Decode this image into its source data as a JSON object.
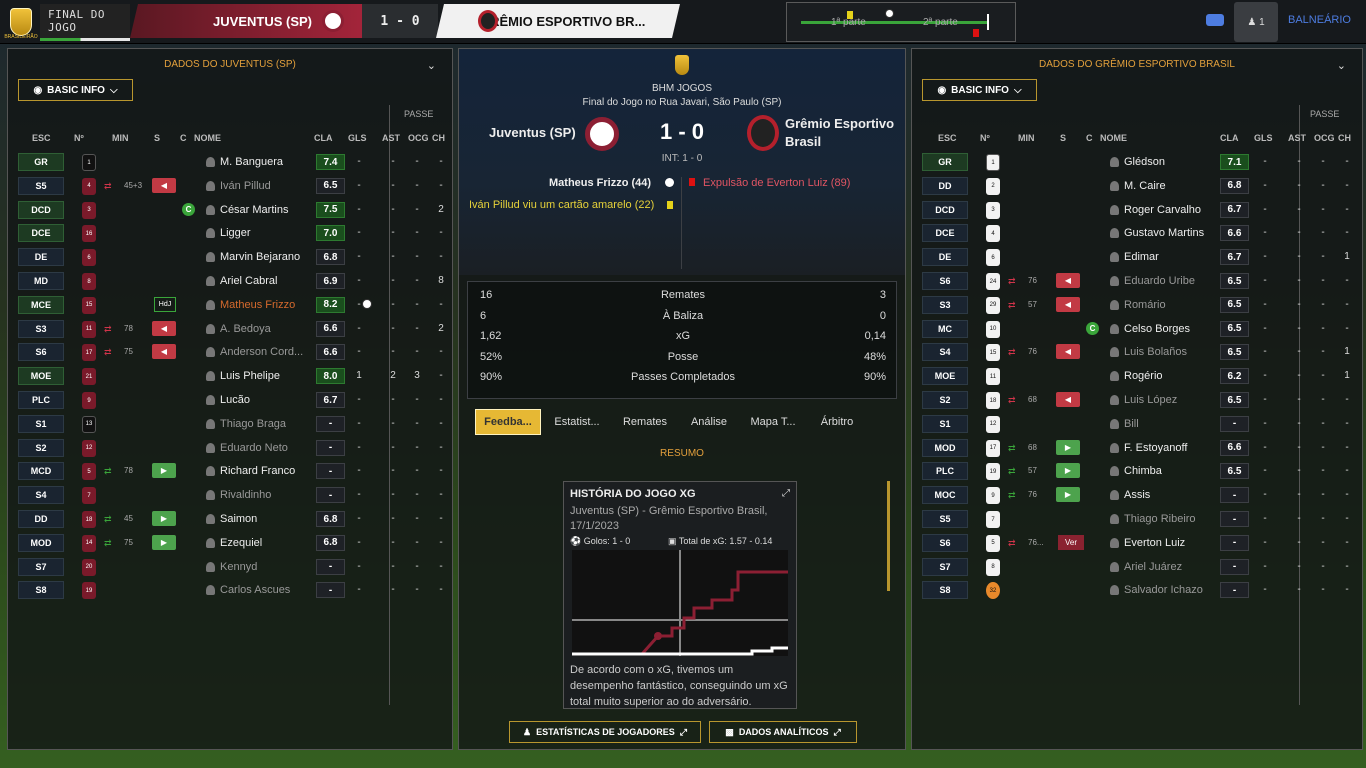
{
  "topbar": {
    "logo_text": "BRASILEIRÃO",
    "final": "FINAL DO JOGO",
    "home": "JUVENTUS (SP)",
    "score": "1 - 0",
    "away": "GRÊMIO ESPORTIVO BR...",
    "tl_half1": "1ª parte",
    "tl_half2": "2ª parte",
    "user_count": "1",
    "balneario": "BALNEÁRIO"
  },
  "left": {
    "title": "DADOS DO JUVENTUS (SP)",
    "basic": "BASIC INFO",
    "passe": "PASSE",
    "headers": [
      "ESC",
      "Nº",
      "MIN",
      "S",
      "C",
      "NOME",
      "CLA",
      "GLS",
      "AST",
      "OCG",
      "CH"
    ],
    "players": [
      {
        "pos": "GR",
        "num": "1",
        "name": "M. Banguera",
        "rating": "7.4",
        "gls": "-",
        "ast": "-",
        "ocg": "-",
        "ch": "-",
        "good": true,
        "gk": true
      },
      {
        "pos": "S5",
        "num": "4",
        "name": "Iván Pillud",
        "rating": "6.5",
        "gls": "-",
        "ast": "-",
        "ocg": "-",
        "ch": "-",
        "sub": "45+3",
        "subout": true,
        "dim": true
      },
      {
        "pos": "DCD",
        "num": "3",
        "name": "César Martins",
        "rating": "7.5",
        "gls": "-",
        "ast": "-",
        "ocg": "-",
        "ch": "2",
        "good": true,
        "cap": "C"
      },
      {
        "pos": "DCE",
        "num": "16",
        "name": "Ligger",
        "rating": "7.0",
        "gls": "-",
        "ast": "-",
        "ocg": "-",
        "ch": "-",
        "good": true
      },
      {
        "pos": "DE",
        "num": "6",
        "name": "Marvin Bejarano",
        "rating": "6.8",
        "gls": "-",
        "ast": "-",
        "ocg": "-",
        "ch": "-"
      },
      {
        "pos": "MD",
        "num": "8",
        "name": "Ariel Cabral",
        "rating": "6.9",
        "gls": "-",
        "ast": "-",
        "ocg": "-",
        "ch": "8"
      },
      {
        "pos": "MCE",
        "num": "15",
        "name": "Matheus Frizzo",
        "rating": "8.2",
        "gls": "-",
        "ast": "-",
        "ocg": "-",
        "ch": "-",
        "good": true,
        "hdj": "HdJ",
        "hl": true,
        "goal": true
      },
      {
        "pos": "S3",
        "num": "11",
        "name": "A. Bedoya",
        "rating": "6.6",
        "gls": "-",
        "ast": "-",
        "ocg": "-",
        "ch": "2",
        "sub": "78",
        "subout": true,
        "dim": true
      },
      {
        "pos": "S6",
        "num": "17",
        "name": "Anderson Cord...",
        "rating": "6.6",
        "gls": "-",
        "ast": "-",
        "ocg": "-",
        "ch": "-",
        "sub": "75",
        "subout": true,
        "dim": true
      },
      {
        "pos": "MOE",
        "num": "21",
        "name": "Luis Phelipe",
        "rating": "8.0",
        "gls": "1",
        "ast": "2",
        "ocg": "3",
        "ch": "-",
        "good": true
      },
      {
        "pos": "PLC",
        "num": "9",
        "name": "Lucão",
        "rating": "6.7",
        "gls": "-",
        "ast": "-",
        "ocg": "-",
        "ch": "-"
      },
      {
        "pos": "S1",
        "num": "13",
        "name": "Thiago Braga",
        "rating": "-",
        "gls": "-",
        "ast": "-",
        "ocg": "-",
        "ch": "-",
        "dim": true,
        "gk": true
      },
      {
        "pos": "S2",
        "num": "12",
        "name": "Eduardo Neto",
        "rating": "-",
        "gls": "-",
        "ast": "-",
        "ocg": "-",
        "ch": "-",
        "dim": true
      },
      {
        "pos": "MCD",
        "num": "5",
        "name": "Richard Franco",
        "rating": "-",
        "gls": "-",
        "ast": "-",
        "ocg": "-",
        "ch": "-",
        "sub": "78",
        "subin": true
      },
      {
        "pos": "S4",
        "num": "7",
        "name": "Rivaldinho",
        "rating": "-",
        "gls": "-",
        "ast": "-",
        "ocg": "-",
        "ch": "-",
        "dim": true
      },
      {
        "pos": "DD",
        "num": "18",
        "name": "Saimon",
        "rating": "6.8",
        "gls": "-",
        "ast": "-",
        "ocg": "-",
        "ch": "-",
        "sub": "45",
        "subin": true
      },
      {
        "pos": "MOD",
        "num": "14",
        "name": "Ezequiel",
        "rating": "6.8",
        "gls": "-",
        "ast": "-",
        "ocg": "-",
        "ch": "-",
        "sub": "75",
        "subin": true
      },
      {
        "pos": "S7",
        "num": "20",
        "name": "Kennyd",
        "rating": "-",
        "gls": "-",
        "ast": "-",
        "ocg": "-",
        "ch": "-",
        "dim": true
      },
      {
        "pos": "S8",
        "num": "19",
        "name": "Carlos Ascues",
        "rating": "-",
        "gls": "-",
        "ast": "-",
        "ocg": "-",
        "ch": "-",
        "dim": true
      }
    ]
  },
  "right": {
    "title": "DADOS DO GRÊMIO ESPORTIVO BRASIL",
    "basic": "BASIC INFO",
    "passe": "PASSE",
    "headers": [
      "ESC",
      "Nº",
      "MIN",
      "S",
      "C",
      "NOME",
      "CLA",
      "GLS",
      "AST",
      "OCG",
      "CH"
    ],
    "players": [
      {
        "pos": "GR",
        "num": "1",
        "name": "Glédson",
        "rating": "7.1",
        "gls": "-",
        "ast": "-",
        "ocg": "-",
        "ch": "-",
        "good": true,
        "gk": true
      },
      {
        "pos": "DD",
        "num": "2",
        "name": "M. Caire",
        "rating": "6.8",
        "gls": "-",
        "ast": "-",
        "ocg": "-",
        "ch": "-"
      },
      {
        "pos": "DCD",
        "num": "3",
        "name": "Roger Carvalho",
        "rating": "6.7",
        "gls": "-",
        "ast": "-",
        "ocg": "-",
        "ch": "-"
      },
      {
        "pos": "DCE",
        "num": "4",
        "name": "Gustavo Martins",
        "rating": "6.6",
        "gls": "-",
        "ast": "-",
        "ocg": "-",
        "ch": "-"
      },
      {
        "pos": "DE",
        "num": "6",
        "name": "Edimar",
        "rating": "6.7",
        "gls": "-",
        "ast": "-",
        "ocg": "-",
        "ch": "1"
      },
      {
        "pos": "S6",
        "num": "24",
        "name": "Eduardo Uribe",
        "rating": "6.5",
        "gls": "-",
        "ast": "-",
        "ocg": "-",
        "ch": "-",
        "sub": "76",
        "subout": true,
        "dim": true
      },
      {
        "pos": "S3",
        "num": "29",
        "name": "Romário",
        "rating": "6.5",
        "gls": "-",
        "ast": "-",
        "ocg": "-",
        "ch": "-",
        "sub": "57",
        "subout": true,
        "dim": true
      },
      {
        "pos": "MC",
        "num": "10",
        "name": "Celso Borges",
        "rating": "6.5",
        "gls": "-",
        "ast": "-",
        "ocg": "-",
        "ch": "-",
        "cap": "C"
      },
      {
        "pos": "S4",
        "num": "15",
        "name": "Luis Bolaños",
        "rating": "6.5",
        "gls": "-",
        "ast": "-",
        "ocg": "-",
        "ch": "1",
        "sub": "76",
        "subout": true,
        "dim": true
      },
      {
        "pos": "MOE",
        "num": "11",
        "name": "Rogério",
        "rating": "6.2",
        "gls": "-",
        "ast": "-",
        "ocg": "-",
        "ch": "1"
      },
      {
        "pos": "S2",
        "num": "18",
        "name": "Luis López",
        "rating": "6.5",
        "gls": "-",
        "ast": "-",
        "ocg": "-",
        "ch": "-",
        "sub": "68",
        "subout": true,
        "dim": true
      },
      {
        "pos": "S1",
        "num": "12",
        "name": "Bill",
        "rating": "-",
        "gls": "-",
        "ast": "-",
        "ocg": "-",
        "ch": "-",
        "dim": true
      },
      {
        "pos": "MOD",
        "num": "17",
        "name": "F. Estoyanoff",
        "rating": "6.6",
        "gls": "-",
        "ast": "-",
        "ocg": "-",
        "ch": "-",
        "sub": "68",
        "subin": true
      },
      {
        "pos": "PLC",
        "num": "19",
        "name": "Chimba",
        "rating": "6.5",
        "gls": "-",
        "ast": "-",
        "ocg": "-",
        "ch": "-",
        "sub": "57",
        "subin": true
      },
      {
        "pos": "MOC",
        "num": "9",
        "name": "Assis",
        "rating": "-",
        "gls": "-",
        "ast": "-",
        "ocg": "-",
        "ch": "-",
        "sub": "76",
        "subin": true
      },
      {
        "pos": "S5",
        "num": "7",
        "name": "Thiago Ribeiro",
        "rating": "-",
        "gls": "-",
        "ast": "-",
        "ocg": "-",
        "ch": "-",
        "dim": true
      },
      {
        "pos": "S6",
        "num": "5",
        "name": "Everton Luiz",
        "rating": "-",
        "gls": "-",
        "ast": "-",
        "ocg": "-",
        "ch": "-",
        "sub": "76...",
        "ver": "Ver"
      },
      {
        "pos": "S7",
        "num": "8",
        "name": "Ariel Juárez",
        "rating": "-",
        "gls": "-",
        "ast": "-",
        "ocg": "-",
        "ch": "-",
        "dim": true
      },
      {
        "pos": "S8",
        "num": "32",
        "name": "Salvador Ichazo",
        "rating": "-",
        "gls": "-",
        "ast": "-",
        "ocg": "-",
        "ch": "-",
        "dim": true,
        "agk": true
      }
    ]
  },
  "center": {
    "broadcaster": "BHM JOGOS",
    "venue": "Final do Jogo no Rua Javari, São Paulo (SP)",
    "home": "Juventus (SP)",
    "away": "Grêmio Esportivo Brasil",
    "score": "1 - 0",
    "int": "INT: 1 - 0",
    "goal_event": "Matheus Frizzo (44)",
    "red_event": "Expulsão de Everton Luiz (89)",
    "yellow_event": "Iván Pillud viu um cartão amarelo (22)",
    "stats": [
      {
        "l": "16",
        "m": "Remates",
        "r": "3"
      },
      {
        "l": "6",
        "m": "À Baliza",
        "r": "0"
      },
      {
        "l": "1,62",
        "m": "xG",
        "r": "0,14"
      },
      {
        "l": "52%",
        "m": "Posse",
        "r": "48%"
      },
      {
        "l": "90%",
        "m": "Passes Completados",
        "r": "90%"
      }
    ],
    "tabs": [
      "Feedba...",
      "Estatist...",
      "Remates",
      "Análise",
      "Mapa T...",
      "Árbitro"
    ],
    "resumo": "RESUMO",
    "xg_title": "HISTÓRIA DO JOGO XG",
    "xg_sub": "Juventus (SP) - Grêmio Esportivo Brasil, 17/1/2023",
    "xg_goals": "Golos: 1 - 0",
    "xg_total": "Total de xG: 1.57 - 0.14",
    "xg_text": "De acordo com o xG, tivemos um desempenho fantástico, conseguindo um xG total muito superior ao do adversário.",
    "btn_stats": "ESTATÍSTICAS DE JOGADORES",
    "btn_data": "DADOS ANALÍTICOS"
  },
  "colors": {
    "accent": "#e3a03c",
    "home": "#8c1f33",
    "gold": "#b8962e",
    "good_rating": "#1a4e1d"
  }
}
